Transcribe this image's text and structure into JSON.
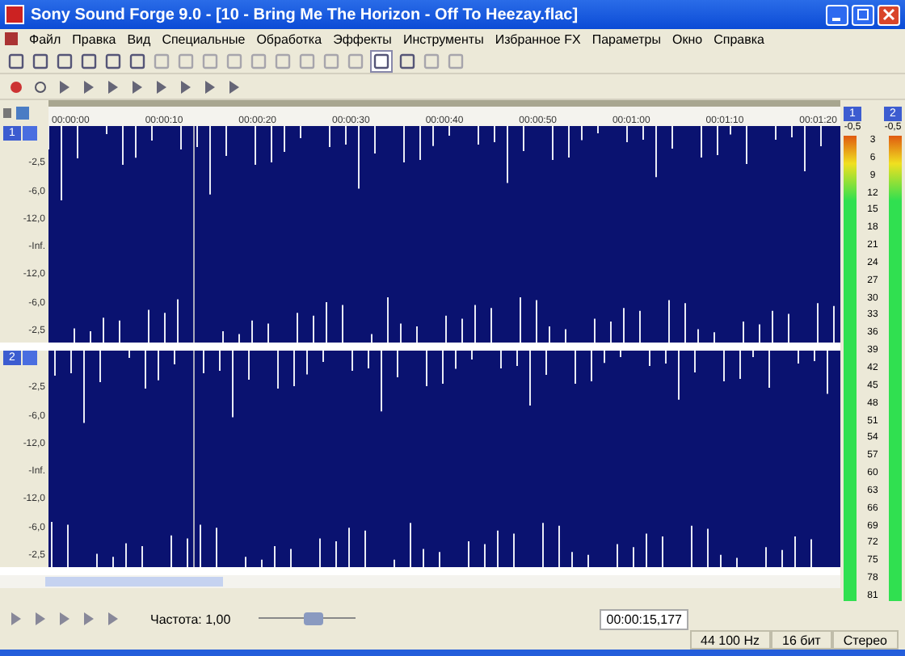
{
  "window": {
    "title": "Sony Sound Forge 9.0 - [10 - Bring Me The Horizon - Off To Heezay.flac]"
  },
  "menu": [
    "Файл",
    "Правка",
    "Вид",
    "Специальные",
    "Обработка",
    "Эффекты",
    "Инструменты",
    "Избранное FX",
    "Параметры",
    "Окно",
    "Справка"
  ],
  "data_window": {
    "ruler": [
      "00:00:00",
      "00:00:10",
      "00:00:20",
      "00:00:30",
      "00:00:40",
      "00:00:50",
      "00:01:00",
      "00:01:10",
      "00:01:20"
    ],
    "channels": [
      {
        "label": "1",
        "scale": [
          "-2,5",
          "-6,0",
          "-12,0",
          "-Inf.",
          "-12,0",
          "-6,0",
          "-2,5"
        ]
      },
      {
        "label": "2",
        "scale": [
          "-2,5",
          "-6,0",
          "-12,0",
          "-Inf.",
          "-12,0",
          "-6,0",
          "-2,5"
        ]
      }
    ]
  },
  "meters": {
    "channels": [
      {
        "label": "1",
        "peak": "-0,5",
        "level": 1
      },
      {
        "label": "2",
        "peak": "-0,5",
        "level": 1
      }
    ],
    "scale": [
      "3",
      "6",
      "9",
      "12",
      "15",
      "18",
      "21",
      "24",
      "27",
      "30",
      "33",
      "36",
      "39",
      "42",
      "45",
      "48",
      "51",
      "54",
      "57",
      "60",
      "63",
      "66",
      "69",
      "72",
      "75",
      "78",
      "81"
    ]
  },
  "transport": {
    "rate": "Частота: 1,00",
    "level": 0.6,
    "position": "00:00:15,177"
  },
  "status_bar": [
    "44 100 Hz",
    "16 бит",
    "Стерео"
  ]
}
